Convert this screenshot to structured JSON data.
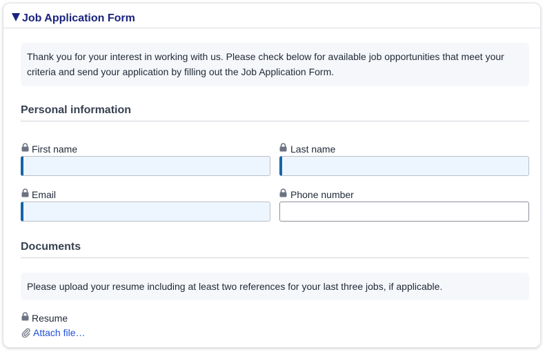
{
  "form": {
    "title": "Job Application Form",
    "intro": "Thank you for your interest in working with us. Please check below for available job opportunities that meet your criteria and send your application by filling out the Job Application Form."
  },
  "sections": {
    "personal": {
      "heading": "Personal information",
      "fields": {
        "first_name": {
          "label": "First name",
          "value": ""
        },
        "last_name": {
          "label": "Last name",
          "value": ""
        },
        "email": {
          "label": "Email",
          "value": ""
        },
        "phone": {
          "label": "Phone number",
          "value": ""
        }
      }
    },
    "documents": {
      "heading": "Documents",
      "note": "Please upload your resume including at least two references for your last three jobs, if applicable.",
      "resume_label": "Resume",
      "attach_label": "Attach file…"
    }
  },
  "icons": {
    "collapse": "caret-down-icon",
    "field_lock": "lock-icon",
    "attach": "paperclip-icon"
  },
  "colors": {
    "title": "#1a237e",
    "required_marker": "#1565a8",
    "input_fill": "#edf6fe",
    "link": "#1d4ed8",
    "notice_bg": "#f5f7fa"
  }
}
